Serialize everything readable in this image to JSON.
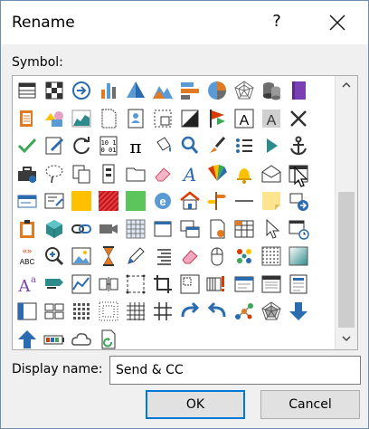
{
  "dialog": {
    "title": "Rename",
    "help_glyph": "?",
    "close_icon": "close-icon"
  },
  "symbol_label": "Symbol:",
  "symbols": {
    "rows": 11,
    "cols": 12,
    "selected": {
      "row": 3,
      "col": 11
    },
    "icons": [
      "table-icon",
      "checker-icon",
      "arrow-right-circle-icon",
      "bar-chart-icon",
      "pyramid-icon",
      "mountain-chart-icon",
      "bar-horizontal-icon",
      "pie-chart-icon",
      "radar-chart-icon",
      "database-icon",
      "book-icon",
      "",
      "sheets-icon",
      "shapes-icon",
      "area-chart-icon",
      "document-icon",
      "contact-card-icon",
      "dotted-image-icon",
      "contrast-icon",
      "flag-icon",
      "text-box-icon",
      "text-grey-icon",
      "cross-icon",
      "",
      "checkmark-icon",
      "edit-icon",
      "refresh-icon",
      "binary-icon",
      "pi-icon",
      "paint-bucket-icon",
      "search-icon",
      "brush-icon",
      "bullets-icon",
      "play-icon",
      "anchor-icon",
      "",
      "toolbox-icon",
      "lasso-icon",
      "copy-icon",
      "server-icon",
      "folder-icon",
      "eraser-icon",
      "font-a-icon",
      "color-fan-icon",
      "bell-icon",
      "envelope-icon",
      "window-icon",
      "",
      "card-icon",
      "form-icon",
      "yellow-swatch-icon",
      "red-stripe-icon",
      "green-swatch-icon",
      "browser-icon",
      "house-icon",
      "signpost-icon",
      "line-icon",
      "sticky-note-icon",
      "transfer-icon",
      "",
      "clipboard-icon",
      "cube-icon",
      "link-icon",
      "camcorder-icon",
      "table-grid-icon",
      "window-small-icon",
      "windows-stack-icon",
      "certificate-icon",
      "calc-table-icon",
      "pointer-icon",
      "schedule-icon",
      "",
      "spelling-icon",
      "magnifier-icon",
      "picture-icon",
      "hourglass-icon",
      "pen-icon",
      "align-right-icon",
      "eraser-pink-icon",
      "mouse-icon",
      "dots-icon",
      "pattern-icon",
      "gradient-icon",
      "",
      "text-aa-icon",
      "flag-teal-icon",
      "chart-split-icon",
      "columns-icon",
      "dashed-box-icon",
      "crop-icon",
      "layout-icon",
      "tabs-alert-icon",
      "dialog-icon",
      "window-grid-icon",
      "form-icon-2",
      "",
      "sidebar-icon",
      "grid-4-icon",
      "dots-grid-icon",
      "dotted-rect-icon",
      "hash-grid-icon",
      "hash-icon",
      "redo-icon",
      "undo-icon",
      "molecule-icon",
      "spider-icon",
      "arrow-down-icon",
      "",
      "arrow-up-icon",
      "battery-icon",
      "cloud-icon",
      "refresh-doc-icon",
      "",
      "",
      "",
      "",
      "",
      "",
      "",
      ""
    ]
  },
  "display_name_label": "Display name:",
  "display_name_value": "Send & CC",
  "buttons": {
    "ok": "OK",
    "cancel": "Cancel"
  }
}
